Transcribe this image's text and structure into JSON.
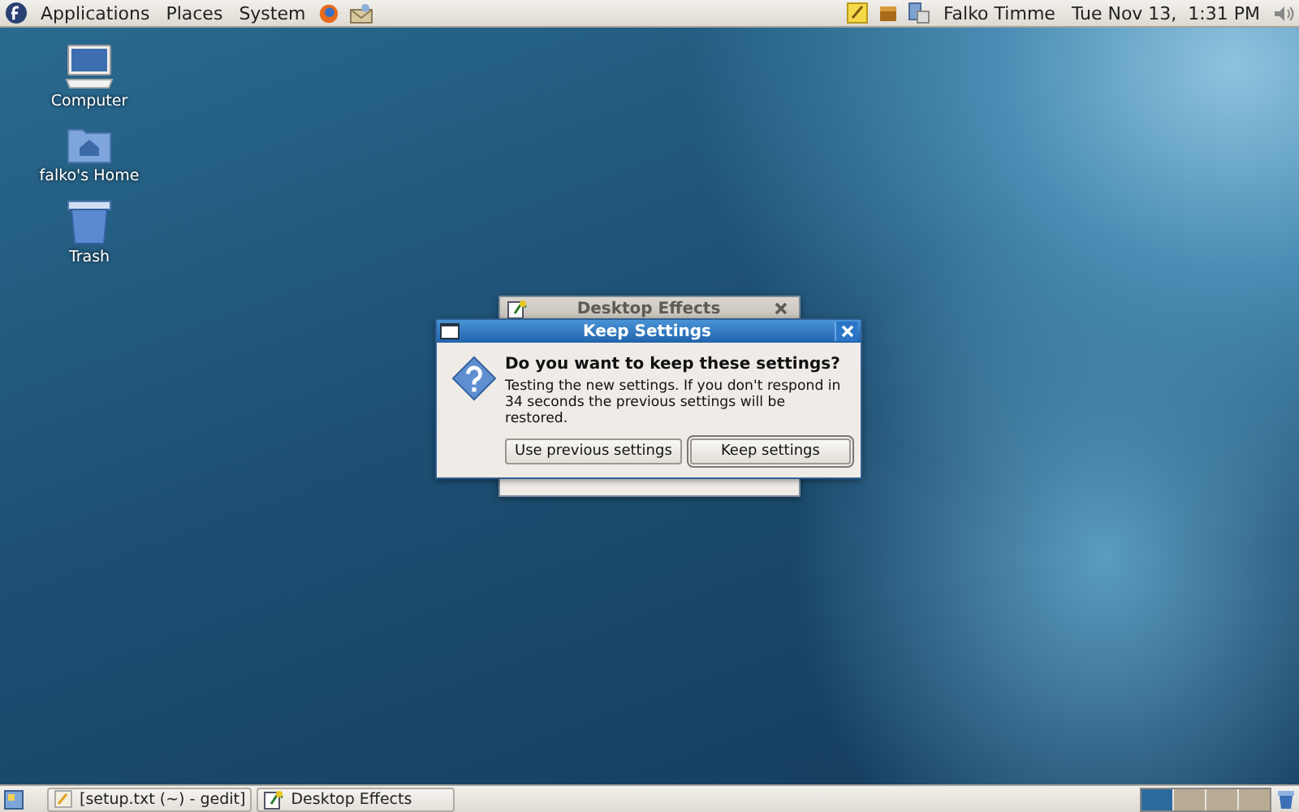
{
  "top_panel": {
    "menus": [
      "Applications",
      "Places",
      "System"
    ],
    "user": "Falko Timme",
    "clock": "Tue Nov 13,  1:31 PM"
  },
  "desktop_icons": [
    {
      "kind": "computer",
      "label": "Computer"
    },
    {
      "kind": "home",
      "label": "falko's Home"
    },
    {
      "kind": "trash",
      "label": "Trash"
    }
  ],
  "background_window": {
    "title": "Desktop Effects"
  },
  "dialog": {
    "title": "Keep Settings",
    "heading": "Do you want to keep these settings?",
    "message": "Testing the new settings. If you don't respond in 34 seconds the previous settings will be restored.",
    "buttons": [
      {
        "label": "Use previous settings",
        "default": false
      },
      {
        "label": "Keep settings",
        "default": true
      }
    ]
  },
  "taskbar": {
    "tasks": [
      {
        "kind": "editor",
        "label": "[setup.txt (~) - gedit]"
      },
      {
        "kind": "effects",
        "label": "Desktop Effects"
      }
    ],
    "workspaces": [
      {
        "selected": true
      },
      {
        "selected": false
      },
      {
        "selected": false
      },
      {
        "selected": false
      }
    ]
  }
}
